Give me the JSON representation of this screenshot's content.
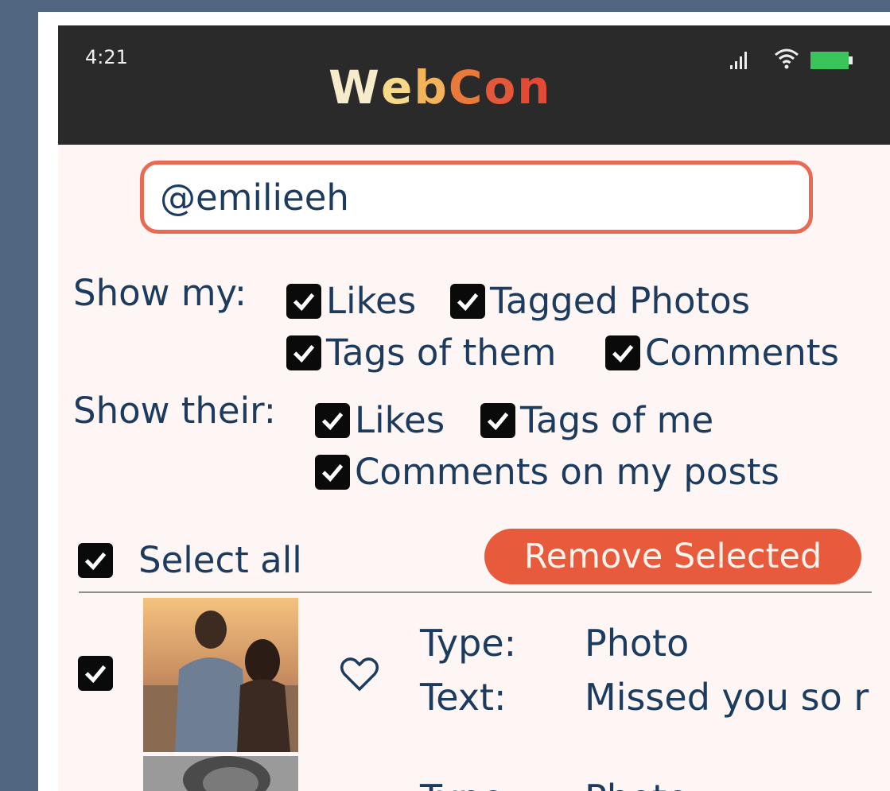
{
  "status_bar": {
    "time": "4:21",
    "app_logo": "WebCon"
  },
  "search": {
    "value": "@emilieeh"
  },
  "filters": {
    "show_my_label": "Show my:",
    "show_my_options": [
      "Likes",
      "Tagged Photos",
      "Tags of them",
      "Comments"
    ],
    "show_their_label": "Show their:",
    "show_their_options": [
      "Likes",
      "Tags of me",
      "Comments on my posts"
    ]
  },
  "actions": {
    "select_all_label": "Select all",
    "remove_selected_label": "Remove Selected"
  },
  "items": [
    {
      "type_label": "Type:",
      "type_value": "Photo",
      "text_label": "Text:",
      "text_value": "Missed you so r"
    },
    {
      "type_label": "Type:",
      "type_value": "Photo"
    }
  ],
  "icons": [
    "signal-icon",
    "wifi-icon",
    "battery-icon",
    "checkbox-checked-icon",
    "heart-icon"
  ],
  "colors": {
    "background": "#516680",
    "screen": "#fdf6f4",
    "status_bar": "#2a2a2a",
    "accent": "#e85a3c",
    "text": "#1d3b5e"
  }
}
